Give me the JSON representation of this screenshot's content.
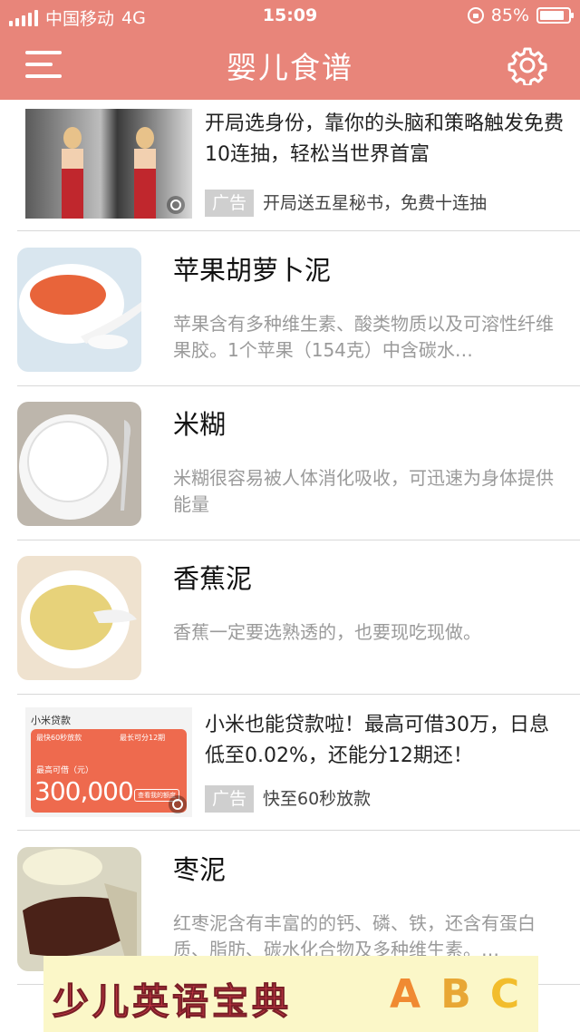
{
  "status_bar": {
    "carrier": "中国移动",
    "network": "4G",
    "time": "15:09",
    "battery": "85%",
    "battery_level": 0.85
  },
  "header": {
    "title": "婴儿食谱",
    "menu_icon": "menu-icon",
    "settings_icon": "gear-icon"
  },
  "ads": [
    {
      "title": "开局选身份，靠你的头脑和策略触发免费10连抽，轻松当世界首富",
      "tag": "广告",
      "subtitle": "开局送五星秘书，免费十连抽"
    },
    {
      "title": "小米也能贷款啦！最高可借30万，日息低至0.02%，还能分12期还！",
      "tag": "广告",
      "subtitle": "快至60秒放款",
      "thumb": {
        "brand": "小米贷款",
        "line1": "最快60秒放款",
        "line2": "最长可分12期",
        "label": "最高可借（元）",
        "amount": "300,000",
        "button": "查看我的额度"
      }
    }
  ],
  "recipes": [
    {
      "name": "苹果胡萝卜泥",
      "desc": "苹果含有多种维生素、酸类物质以及可溶性纤维果胶。1个苹果（154克）中含碳水…"
    },
    {
      "name": "米糊",
      "desc": "米糊很容易被人体消化吸收，可迅速为身体提供能量"
    },
    {
      "name": "香蕉泥",
      "desc": "香蕉一定要选熟透的，也要现吃现做。"
    },
    {
      "name": "枣泥",
      "desc": "红枣泥含有丰富的的钙、磷、铁，还含有蛋白质、脂肪、碳水化合物及多种维生素。…"
    }
  ],
  "banner": {
    "text": "少儿英语宝典",
    "letters": [
      "A",
      "B",
      "C"
    ]
  },
  "colors": {
    "header": "#e8857a",
    "divider": "#d8d8d8",
    "desc_text": "#9a9a9a"
  }
}
